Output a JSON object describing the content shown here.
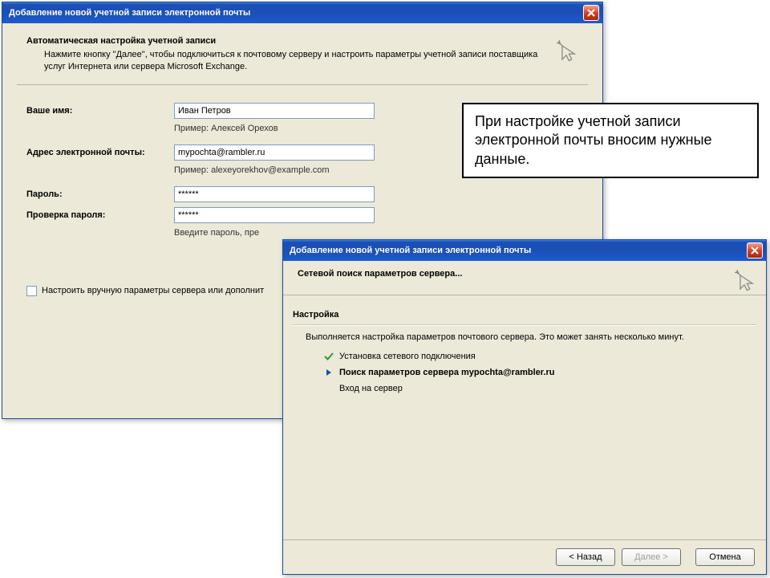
{
  "window1": {
    "title": "Добавление новой учетной записи электронной почты",
    "header_title": "Автоматическая настройка учетной записи",
    "header_desc": "Нажмите кнопку \"Далее\", чтобы подключиться к почтовому серверу и настроить параметры учетной записи поставщика услуг Интернета или сервера Microsoft Exchange.",
    "name_label": "Ваше имя:",
    "name_value": "Иван Петров",
    "name_example": "Пример: Алексей Орехов",
    "email_label": "Адрес электронной почты:",
    "email_value": "mypochta@rambler.ru",
    "email_example": "Пример: alexeyorekhov@example.com",
    "password_label": "Пароль:",
    "password_value": "******",
    "confirm_label": "Проверка пароля:",
    "confirm_value": "******",
    "password_hint": "Введите пароль, пре",
    "manual_label": "Настроить вручную параметры сервера или дополнит"
  },
  "window2": {
    "title": "Добавление новой учетной записи электронной почты",
    "header_title": "Сетевой поиск параметров сервера...",
    "section_title": "Настройка",
    "progress_desc": "Выполняется настройка параметров почтового сервера. Это может занять несколько минут.",
    "step1": "Установка сетевого подключения",
    "step2": "Поиск параметров сервера mypochta@rambler.ru",
    "step3": "Вход на сервер",
    "back_label": "< Назад",
    "next_label": "Далее >",
    "cancel_label": "Отмена"
  },
  "callout": {
    "text": "При настройке учетной записи электронной почты вносим нужные данные."
  }
}
